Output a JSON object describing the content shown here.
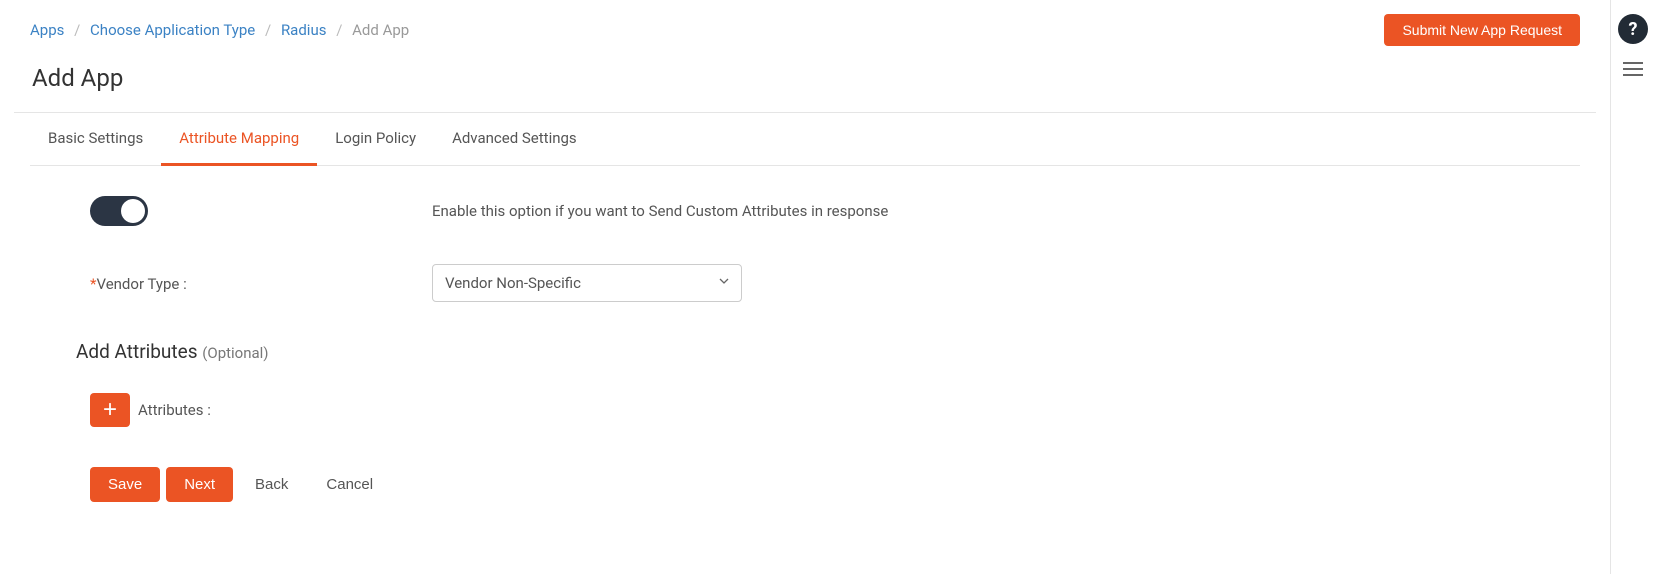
{
  "breadcrumb": {
    "items": [
      {
        "label": "Apps",
        "link": true
      },
      {
        "label": "Choose Application Type",
        "link": true
      },
      {
        "label": "Radius",
        "link": true
      },
      {
        "label": "Add App",
        "link": false
      }
    ]
  },
  "header": {
    "submit_label": "Submit New App Request",
    "page_title": "Add App",
    "help_symbol": "?"
  },
  "tabs": [
    {
      "label": "Basic Settings",
      "active": false
    },
    {
      "label": "Attribute Mapping",
      "active": true
    },
    {
      "label": "Login Policy",
      "active": false
    },
    {
      "label": "Advanced Settings",
      "active": false
    }
  ],
  "form": {
    "toggle_desc": "Enable this option if you want to Send Custom Attributes in response",
    "vendor_label": "Vendor Type :",
    "vendor_value": "Vendor Non-Specific",
    "section_title": "Add Attributes",
    "section_optional": "(Optional)",
    "attributes_label": "Attributes :",
    "add_symbol": "+"
  },
  "buttons": {
    "save": "Save",
    "next": "Next",
    "back": "Back",
    "cancel": "Cancel"
  }
}
